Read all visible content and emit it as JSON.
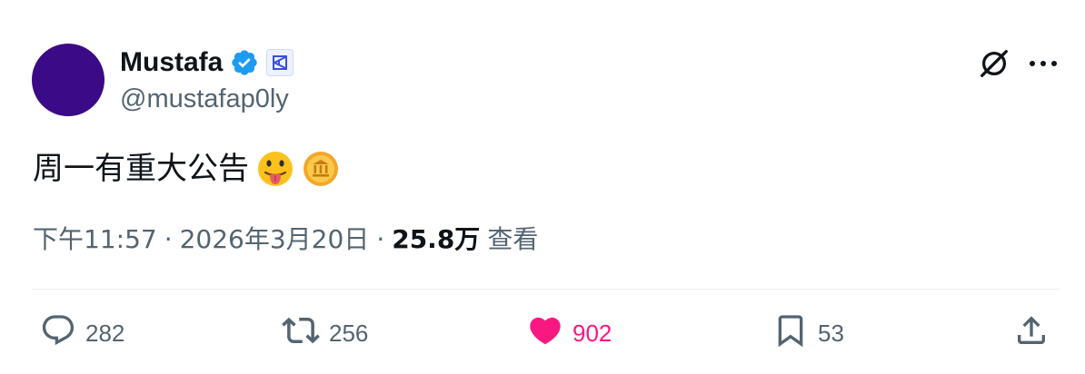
{
  "user": {
    "display_name": "Mustafa",
    "handle": "@mustafap0ly",
    "verified_icon": "verified-badge-icon",
    "affiliate_icon": "affiliate-badge-icon",
    "avatar_color": "#3b0a86"
  },
  "header": {
    "grok_icon": "grok-icon",
    "more_icon": "more-dots-icon"
  },
  "tweet": {
    "text": "周一有重大公告",
    "emojis": [
      "tongue-out-emoji",
      "coin-emoji"
    ]
  },
  "meta": {
    "time": "下午11:57",
    "separator": "·",
    "date": "2026年3月20日",
    "views_count": "25.8万",
    "views_label": "查看"
  },
  "actions": {
    "reply": {
      "icon": "reply-icon",
      "count": "282"
    },
    "retweet": {
      "icon": "retweet-icon",
      "count": "256"
    },
    "like": {
      "icon": "heart-icon",
      "count": "902",
      "color": "#f91880"
    },
    "bookmark": {
      "icon": "bookmark-icon",
      "count": "53"
    },
    "share": {
      "icon": "share-icon"
    }
  }
}
